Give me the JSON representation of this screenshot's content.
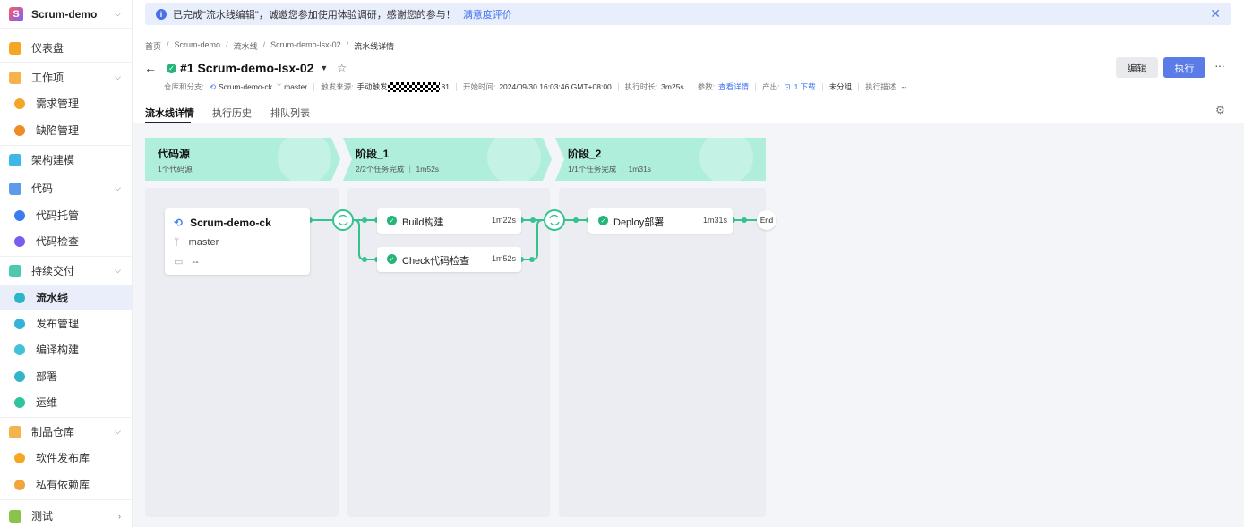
{
  "project": {
    "name": "Scrum-demo"
  },
  "sidebar": {
    "items": [
      {
        "label": "仪表盘",
        "color": "#f5a623"
      },
      {
        "label": "工作项",
        "color": "#f7b24a"
      },
      {
        "label": "需求管理",
        "color": "#f5a623"
      },
      {
        "label": "缺陷管理",
        "color": "#f08a24"
      },
      {
        "label": "架构建模",
        "color": "#3db6e8"
      },
      {
        "label": "代码",
        "color": "#5c9be8"
      },
      {
        "label": "代码托管",
        "color": "#3b7cf0"
      },
      {
        "label": "代码检查",
        "color": "#7a5cf0"
      },
      {
        "label": "持续交付",
        "color": "#4cc9b0"
      },
      {
        "label": "流水线",
        "color": "#2bb7c9"
      },
      {
        "label": "发布管理",
        "color": "#36b3d9"
      },
      {
        "label": "编译构建",
        "color": "#40c3d8"
      },
      {
        "label": "部署",
        "color": "#33b5c8"
      },
      {
        "label": "运维",
        "color": "#2ec4a0"
      },
      {
        "label": "制品仓库",
        "color": "#f2b44b"
      },
      {
        "label": "软件发布库",
        "color": "#f5a623"
      },
      {
        "label": "私有依赖库",
        "color": "#f2a33a"
      },
      {
        "label": "测试",
        "color": "#8bc34a"
      }
    ]
  },
  "notice": {
    "text": "已完成\"流水线编辑\"，诚邀您参加使用体验调研，感谢您的参与！",
    "link": "满意度评价"
  },
  "breadcrumb": [
    "首页",
    "Scrum-demo",
    "流水线",
    "Scrum-demo-lsx-02",
    "流水线详情"
  ],
  "run": {
    "title": "#1 Scrum-demo-lsx-02",
    "repo_label": "仓库和分支:",
    "repo": "Scrum-demo-ck",
    "branch": "master",
    "trigger_label": "触发来源:",
    "trigger": "手动触发",
    "trigger_suffix": "81",
    "start_label": "开始时间:",
    "start": "2024/09/30 16:03:46 GMT+08:00",
    "duration_label": "执行时长:",
    "duration": "3m25s",
    "params_label": "参数:",
    "params_link": "查看详情",
    "output_label": "产出:",
    "output_link": "1 下载",
    "group": "未分组",
    "desc_label": "执行描述:",
    "desc": "--"
  },
  "actions": {
    "edit": "编辑",
    "run": "执行",
    "more": "···"
  },
  "tabs": [
    "流水线详情",
    "执行历史",
    "排队列表"
  ],
  "stages": [
    {
      "name": "代码源",
      "sub": "1个代码源"
    },
    {
      "name": "阶段_1",
      "sub": "2/2个任务完成 ｜ 1m52s"
    },
    {
      "name": "阶段_2",
      "sub": "1/1个任务完成 ｜ 1m31s"
    }
  ],
  "source_card": {
    "repo": "Scrum-demo-ck",
    "branch": "master",
    "extra": "--"
  },
  "jobs": [
    {
      "name": "Build构建",
      "time": "1m22s"
    },
    {
      "name": "Check代码检查",
      "time": "1m52s"
    },
    {
      "name": "Deploy部署",
      "time": "1m31s"
    }
  ],
  "end_label": "End",
  "colors": {
    "accent": "#5b7ce8",
    "success": "#27b47a",
    "stage_header": "#aeeedb"
  }
}
